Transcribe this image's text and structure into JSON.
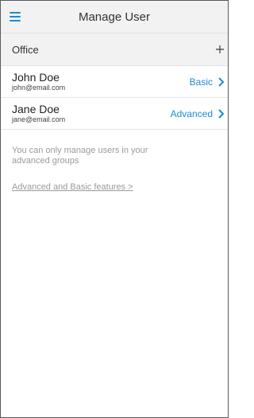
{
  "header": {
    "title": "Manage User",
    "menu_icon": "hamburger-menu-icon"
  },
  "section": {
    "title": "Office",
    "add_icon": "plus-icon"
  },
  "users": [
    {
      "name": "John Doe",
      "email": "john@email.com",
      "level": "Basic"
    },
    {
      "name": "Jane Doe",
      "email": "jane@email.com",
      "level": "Advanced"
    }
  ],
  "note": "You can only manage users in your advanced groups",
  "link": "Advanced and Basic features >",
  "colors": {
    "accent": "#1e8bd1",
    "header_bg": "#f2f2f2",
    "muted_text": "#9a9a9a"
  }
}
